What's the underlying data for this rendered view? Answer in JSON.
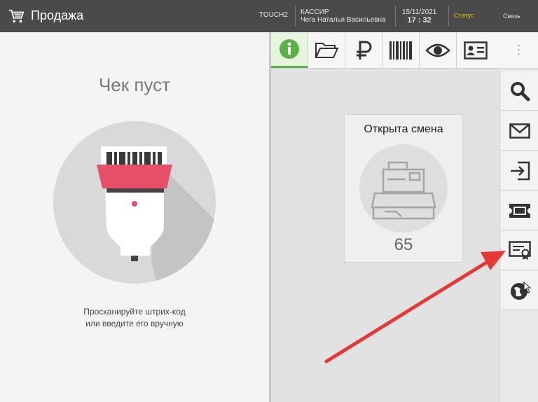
{
  "header": {
    "title": "Продажа",
    "terminal": "TOUCH2",
    "cashier_role": "КАССИР",
    "cashier_name": "Чега Наталья Васильевна",
    "date": "15/11/2021",
    "time": "17 : 32",
    "status_label": "Статус",
    "link_label": "Связь"
  },
  "receipt": {
    "empty_title": "Чек пуст",
    "hint_line1": "Просканируйте штрих-код",
    "hint_line2": "или введите его вручную"
  },
  "toolbar": {
    "items": [
      "info-icon",
      "folder-icon",
      "ruble-icon",
      "barcode-icon",
      "eye-icon",
      "id-card-icon"
    ],
    "active": "info-icon",
    "more": "⋮"
  },
  "shift": {
    "title": "Открыта смена",
    "count": "65"
  },
  "sidebar": {
    "items": [
      "search-icon",
      "mail-icon",
      "login-icon",
      "ticket-icon",
      "certificate-icon",
      "bonus-icon"
    ]
  },
  "colors": {
    "topbar": "#4a4a4a",
    "accent_green": "#5ab14a",
    "status_yellow": "#f2c200",
    "scanner_red": "#e8506a",
    "arrow_red": "#e53935"
  }
}
